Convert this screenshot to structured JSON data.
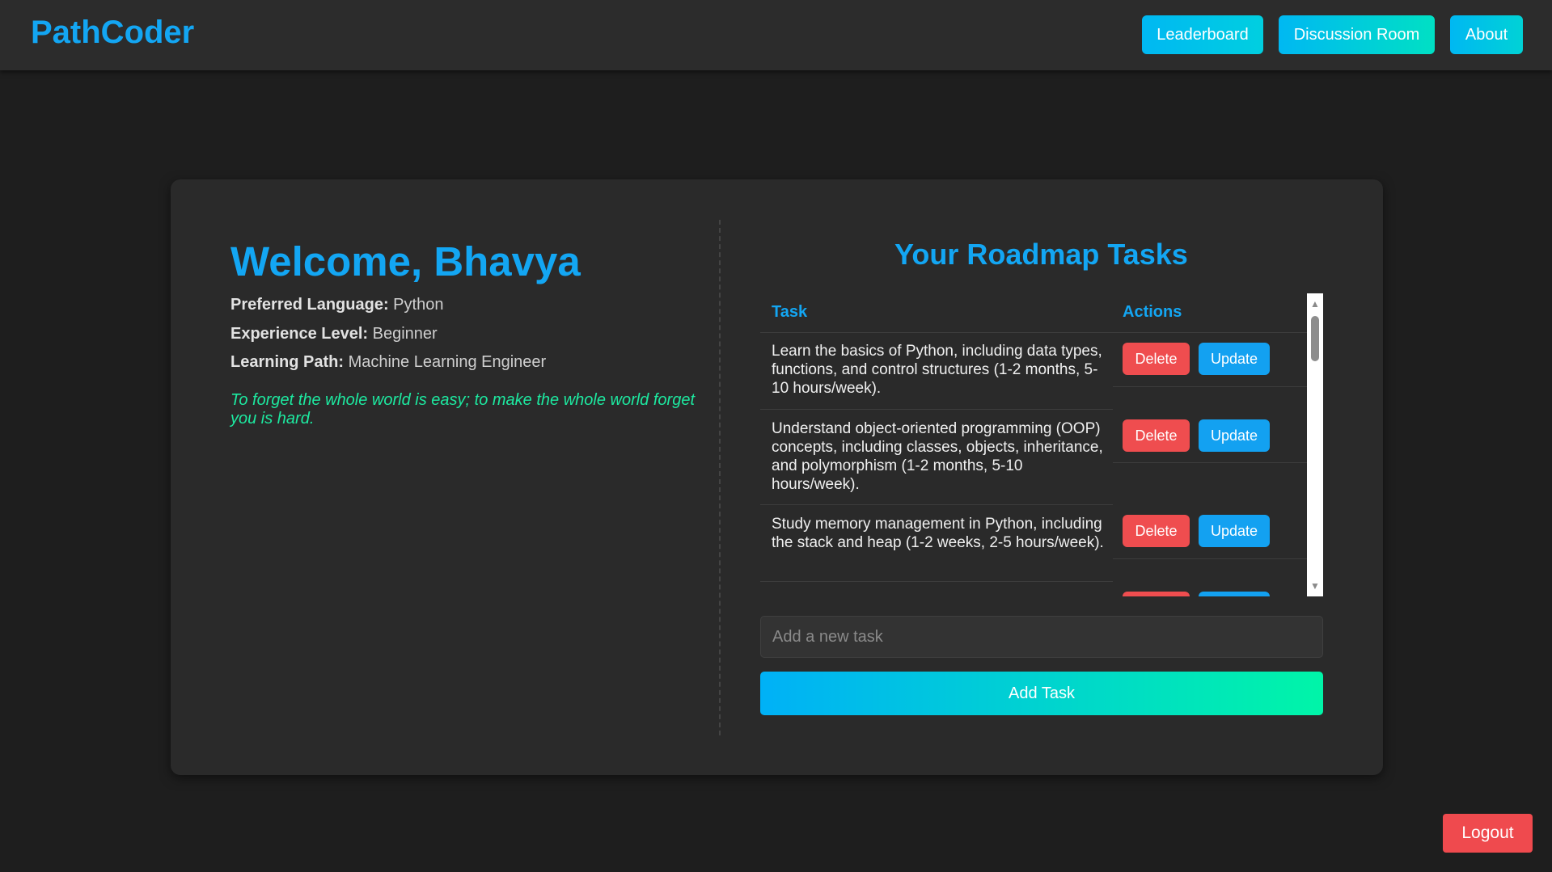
{
  "header": {
    "brand": "PathCoder",
    "nav": {
      "leaderboard": "Leaderboard",
      "discussion": "Discussion Room",
      "about": "About"
    }
  },
  "profile": {
    "welcome": "Welcome, Bhavya",
    "language_label": "Preferred Language:",
    "language_value": "Python",
    "experience_label": "Experience Level:",
    "experience_value": "Beginner",
    "path_label": "Learning Path:",
    "path_value": "Machine Learning Engineer",
    "quote": "To forget the whole world is easy; to make the whole world forget you is hard."
  },
  "roadmap": {
    "title": "Your Roadmap Tasks",
    "columns": {
      "task": "Task",
      "actions": "Actions"
    },
    "tasks": [
      {
        "text": "Learn the basics of Python, including data types, functions, and control structures (1-2 months, 5-10 hours/week).",
        "delete": "Delete",
        "update": "Update"
      },
      {
        "text": "Understand object-oriented programming (OOP) concepts, including classes, objects, inheritance, and polymorphism (1-2 months, 5-10 hours/week).",
        "delete": "Delete",
        "update": "Update"
      },
      {
        "text": "Study memory management in Python, including the stack and heap (1-2 weeks, 2-5 hours/week).",
        "delete": "Delete",
        "update": "Update"
      }
    ],
    "input_placeholder": "Add a new task",
    "add_button": "Add Task"
  },
  "logout": "Logout",
  "colors": {
    "accent": "#13a6f3",
    "quote": "#1de9a0",
    "danger": "#ef4d4f",
    "background": "#1e1e1e",
    "card": "#2a2a2a"
  }
}
